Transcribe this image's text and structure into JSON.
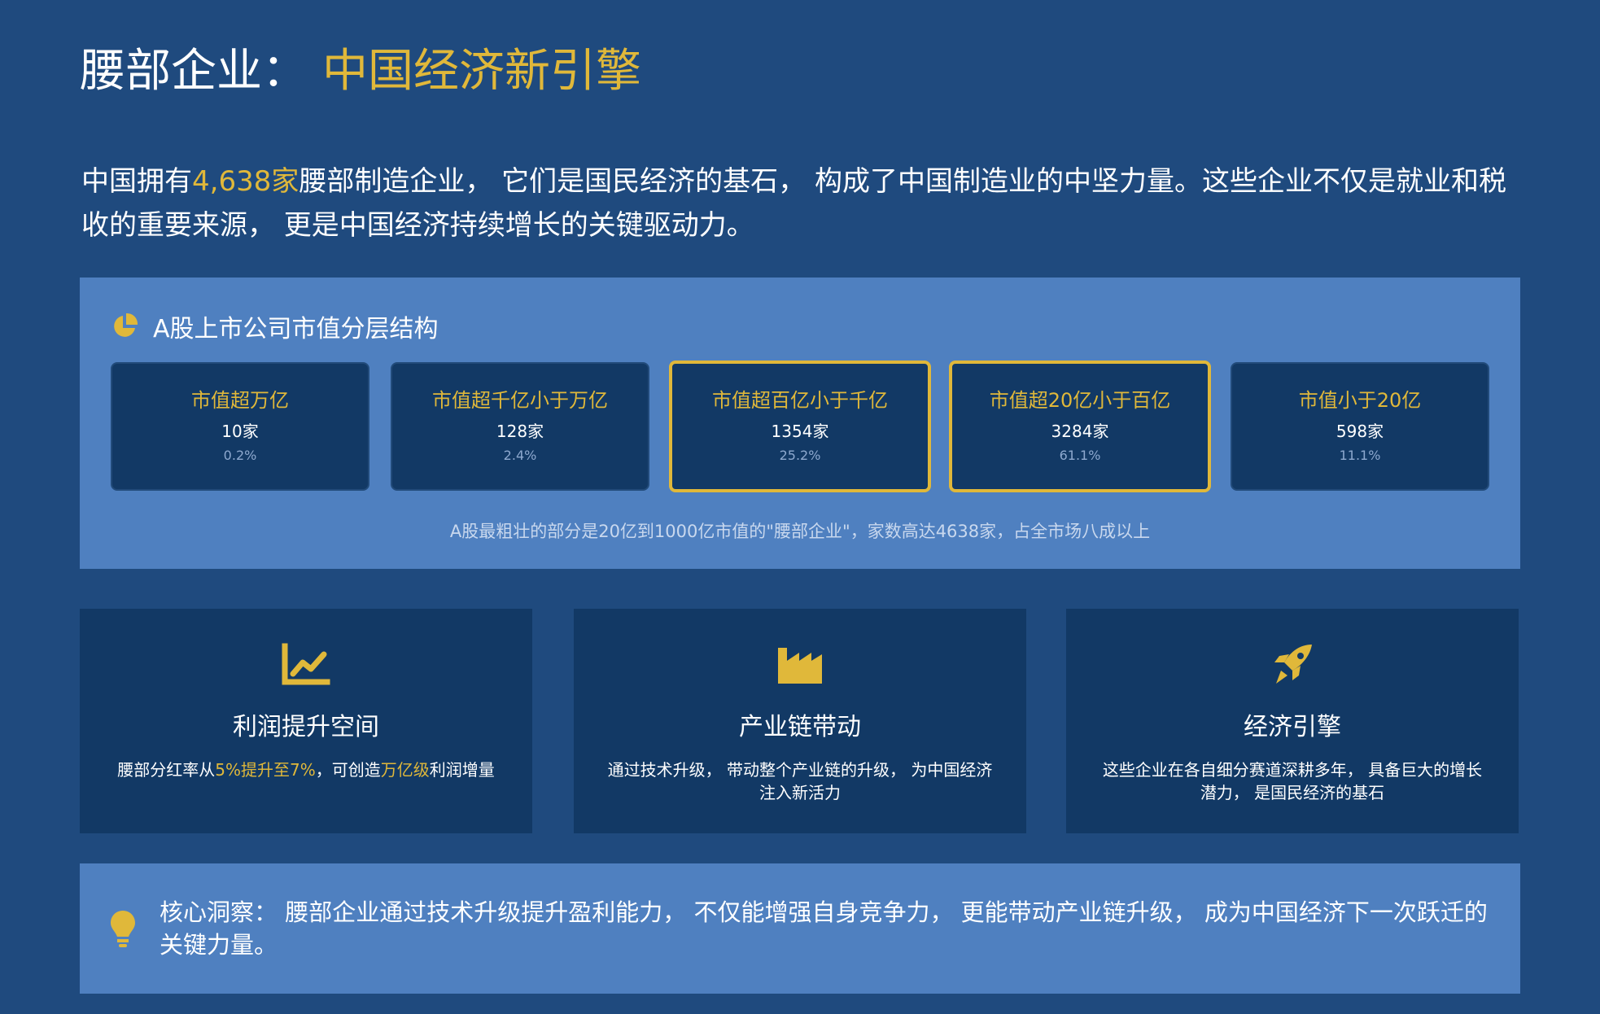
{
  "title": {
    "main": "腰部企业：",
    "accent": "中国经济新引擎"
  },
  "intro": {
    "prefix": "中国拥有",
    "highlight": "4,638家",
    "suffix": "腰部制造企业， 它们是国民经济的基石， 构成了中国制造业的中坚力量。这些企业不仅是就业和税收的重要来源， 更是中国经济持续增长的关键驱动力。"
  },
  "tier_panel": {
    "heading": "A股上市公司市值分层结构",
    "icon": "pie-chart-icon",
    "tiers": [
      {
        "label": "市值超万亿",
        "count": "10家",
        "pct": "0.2%",
        "highlighted": false
      },
      {
        "label": "市值超千亿小于万亿",
        "count": "128家",
        "pct": "2.4%",
        "highlighted": false
      },
      {
        "label": "市值超百亿小于千亿",
        "count": "1354家",
        "pct": "25.2%",
        "highlighted": true
      },
      {
        "label": "市值超20亿小于百亿",
        "count": "3284家",
        "pct": "61.1%",
        "highlighted": true
      },
      {
        "label": "市值小于20亿",
        "count": "598家",
        "pct": "11.1%",
        "highlighted": false
      }
    ],
    "note": "A股最粗壮的部分是20亿到1000亿市值的\"腰部企业\"，家数高达4638家，占全市场八成以上"
  },
  "features": [
    {
      "icon": "line-chart-icon",
      "title": "利润提升空间",
      "desc_parts": [
        "腰部分红率从",
        "5%提升至7%",
        "，可创造",
        "万亿级",
        "利润增量"
      ]
    },
    {
      "icon": "factory-icon",
      "title": "产业链带动",
      "desc": "通过技术升级， 带动整个产业链的升级， 为中国经济注入新活力"
    },
    {
      "icon": "rocket-icon",
      "title": "经济引擎",
      "desc": "这些企业在各自细分赛道深耕多年， 具备巨大的增长潜力， 是国民经济的基石"
    }
  ],
  "insight": {
    "icon": "lightbulb-icon",
    "text": "核心洞察： 腰部企业通过技术升级提升盈利能力， 不仅能增强自身竞争力， 更能带动产业链升级， 成为中国经济下一次跃迁的关键力量。"
  },
  "colors": {
    "background": "#1f4a7e",
    "panel": "#4f80c0",
    "card": "#123965",
    "accent": "#e0b83a"
  }
}
